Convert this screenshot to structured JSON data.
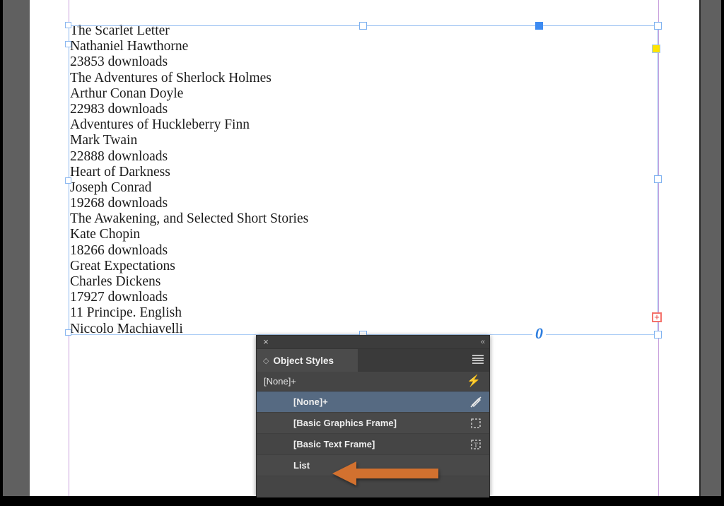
{
  "document": {
    "story_lines": [
      "The Scarlet Letter",
      "Nathaniel Hawthorne",
      "23853 downloads",
      "The Adventures of Sherlock Holmes",
      "Arthur Conan Doyle",
      "22983 downloads",
      "Adventures of Huckleberry Finn",
      "Mark Twain",
      "22888 downloads",
      "Heart of Darkness",
      "Joseph Conrad",
      "19268 downloads",
      "The Awakening, and Selected Short Stories",
      "Kate Chopin",
      "18266 downloads",
      "Great Expectations",
      "Charles Dickens",
      "17927 downloads",
      "11 Principe. English",
      "Niccolo Machiavelli"
    ],
    "page_marker": "0"
  },
  "panel": {
    "close_label": "×",
    "collapse_label": "«",
    "tab_grip": "◇",
    "tab_label": "Object Styles",
    "menu_icon": "hamburger-menu-icon",
    "current_style": "[None]+",
    "apply_icon": "lightning-bolt-icon",
    "rows": [
      {
        "label": "[None]+",
        "icon": "no-pen-icon",
        "selected": true
      },
      {
        "label": "[Basic Graphics Frame]",
        "icon": "graphics-frame-icon",
        "selected": false
      },
      {
        "label": "[Basic Text Frame]",
        "icon": "text-frame-icon",
        "selected": false
      },
      {
        "label": "List",
        "icon": "",
        "selected": false
      }
    ]
  },
  "annotation": {
    "arrow": "left-pointing-arrow",
    "color": "#d2712f",
    "points_to": "List"
  },
  "colors": {
    "selection": "#3d8bf2",
    "handle_outline": "#8cb8f0",
    "corner_radius_handle": "#ffe400",
    "overset_marker": "#e8403a",
    "margin_guide": "#c9a0dc",
    "panel_bg": "#454545",
    "row_selected": "#566a82",
    "pasteboard": "#606060"
  }
}
